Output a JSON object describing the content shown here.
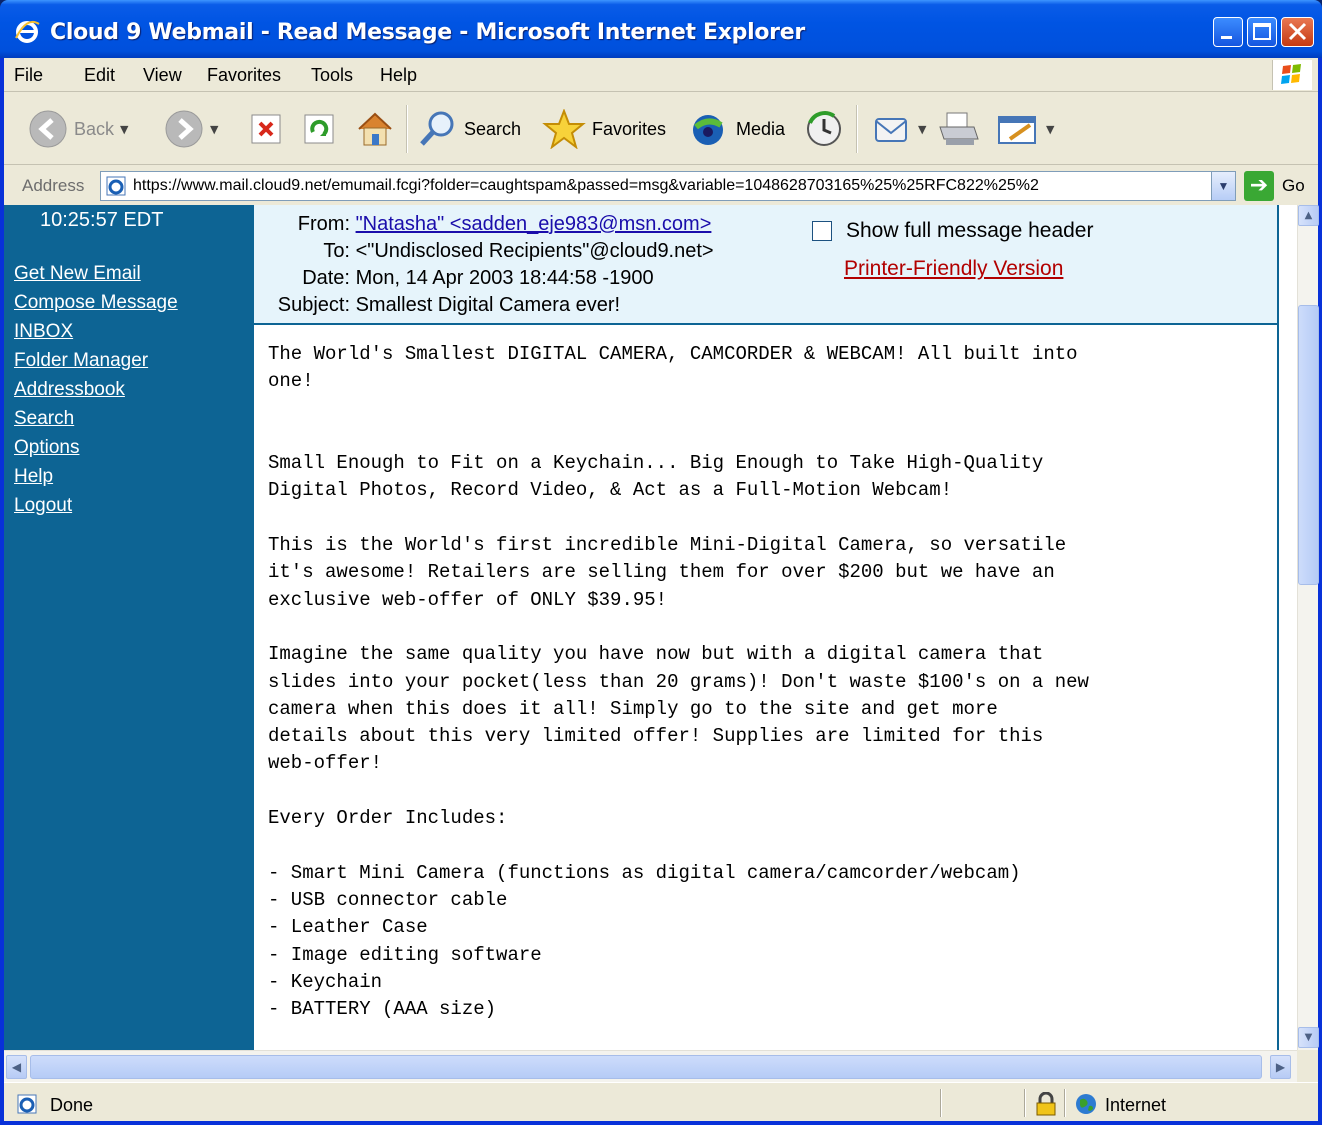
{
  "window": {
    "title": "Cloud 9 Webmail - Read Message - Microsoft Internet Explorer"
  },
  "menu": [
    "File",
    "Edit",
    "View",
    "Favorites",
    "Tools",
    "Help"
  ],
  "toolbar": {
    "back": "Back",
    "search": "Search",
    "favorites": "Favorites",
    "media": "Media"
  },
  "address": {
    "label": "Address",
    "url": "https://www.mail.cloud9.net/emumail.fcgi?folder=caughtspam&passed=msg&variable=1048628703165%25%25RFC822%25%2",
    "go": "Go"
  },
  "sidebar": {
    "time": "10:25:57 EDT",
    "links": [
      "Get New Email",
      "Compose Message",
      "INBOX",
      "Folder Manager",
      "Addressbook",
      "Search",
      "Options",
      "Help",
      "Logout"
    ]
  },
  "message": {
    "from_label": "From:",
    "from_value": "\"Natasha\" <sadden_eje983@msn.com>",
    "to_label": "To:",
    "to_value": "<\"Undisclosed Recipients\"@cloud9.net>",
    "date_label": "Date:",
    "date_value": "Mon, 14 Apr 2003 18:44:58 -1900",
    "subject_label": "Subject:",
    "subject_value": "Smallest Digital Camera ever!",
    "show_header": "Show full message header",
    "printer_friendly": "Printer-Friendly Version",
    "body": "The World's Smallest DIGITAL CAMERA, CAMCORDER & WEBCAM! All built into\none!\n\n\nSmall Enough to Fit on a Keychain... Big Enough to Take High-Quality\nDigital Photos, Record Video, & Act as a Full-Motion Webcam!\n\nThis is the World's first incredible Mini-Digital Camera, so versatile\nit's awesome! Retailers are selling them for over $200 but we have an\nexclusive web-offer of ONLY $39.95!\n\nImagine the same quality you have now but with a digital camera that\nslides into your pocket(less than 20 grams)! Don't waste $100's on a new\ncamera when this does it all! Simply go to the site and get more\ndetails about this very limited offer! Supplies are limited for this\nweb-offer!\n\nEvery Order Includes:\n\n- Smart Mini Camera (functions as digital camera/camcorder/webcam)\n- USB connector cable\n- Leather Case\n- Image editing software\n- Keychain\n- BATTERY (AAA size)"
  },
  "status": {
    "text": "Done",
    "zone": "Internet"
  },
  "colors": {
    "sidebar": "#0d6494",
    "header_bg": "#e6f4fb",
    "titlebar": "#0054e3"
  }
}
